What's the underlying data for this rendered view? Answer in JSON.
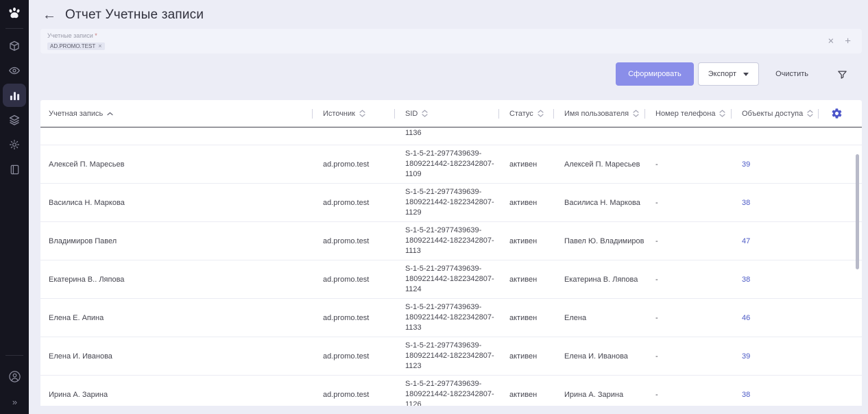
{
  "colors": {
    "accent": "#8a8ee9",
    "link": "#4c5ac6",
    "gear": "#4c55c9",
    "sidebar-bg": "#15151f"
  },
  "sidebar": {
    "icons": [
      "paw-logo",
      "box-icon",
      "eye-icon",
      "bar-chart-icon",
      "layers-icon",
      "gear-icon",
      "book-icon",
      "user-icon",
      "expand-icon"
    ],
    "active_item": "bar-chart",
    "expand_glyph": "»"
  },
  "header": {
    "back_glyph": "←",
    "title": "Отчет Учетные записи"
  },
  "filter": {
    "label": "Учетные записи",
    "required_mark": "*",
    "chip": "AD.PROMO.TEST",
    "chip_remove_glyph": "×",
    "clear_glyph": "×",
    "add_glyph": "+"
  },
  "toolbar": {
    "generate_label": "Сформировать",
    "export_label": "Экспорт",
    "clear_label": "Очистить"
  },
  "table": {
    "columns": [
      {
        "label": "Учетная запись",
        "sort": "asc"
      },
      {
        "label": "Источник",
        "sort": "both"
      },
      {
        "label": "SID",
        "sort": "both"
      },
      {
        "label": "Статус",
        "sort": "both"
      },
      {
        "label": "Имя пользователя",
        "sort": "both"
      },
      {
        "label": "Номер телефона",
        "sort": "both"
      },
      {
        "label": "Объекты доступа",
        "sort": "both"
      }
    ],
    "partial_row": {
      "sid_tail": "1136"
    },
    "rows": [
      {
        "account": "Алексей П. Маресьев",
        "source": "ad.promo.test",
        "sid": "S-1-5-21-2977439639-\n1809221442-1822342807-\n1109",
        "status": "активен",
        "user": "Алексей П. Маресьев",
        "phone": "-",
        "objects": "39"
      },
      {
        "account": "Василиса Н. Маркова",
        "source": "ad.promo.test",
        "sid": "S-1-5-21-2977439639-\n1809221442-1822342807-\n1129",
        "status": "активен",
        "user": "Василиса Н. Маркова",
        "phone": "-",
        "objects": "38"
      },
      {
        "account": "Владимиров Павел",
        "source": "ad.promo.test",
        "sid": "S-1-5-21-2977439639-\n1809221442-1822342807-\n1113",
        "status": "активен",
        "user": "Павел Ю. Владимиров",
        "phone": "-",
        "objects": "47"
      },
      {
        "account": "Екатерина В.. Ляпова",
        "source": "ad.promo.test",
        "sid": "S-1-5-21-2977439639-\n1809221442-1822342807-\n1124",
        "status": "активен",
        "user": "Екатерина В. Ляпова",
        "phone": "-",
        "objects": "38"
      },
      {
        "account": "Елена Е. Апина",
        "source": "ad.promo.test",
        "sid": "S-1-5-21-2977439639-\n1809221442-1822342807-\n1133",
        "status": "активен",
        "user": "Елена",
        "phone": "-",
        "objects": "46"
      },
      {
        "account": "Елена И. Иванова",
        "source": "ad.promo.test",
        "sid": "S-1-5-21-2977439639-\n1809221442-1822342807-\n1123",
        "status": "активен",
        "user": "Елена И. Иванова",
        "phone": "-",
        "objects": "39"
      },
      {
        "account": "Ирина А. Зарина",
        "source": "ad.promo.test",
        "sid": "S-1-5-21-2977439639-\n1809221442-1822342807-\n1126",
        "status": "активен",
        "user": "Ирина А. Зарина",
        "phone": "-",
        "objects": "38"
      }
    ]
  }
}
